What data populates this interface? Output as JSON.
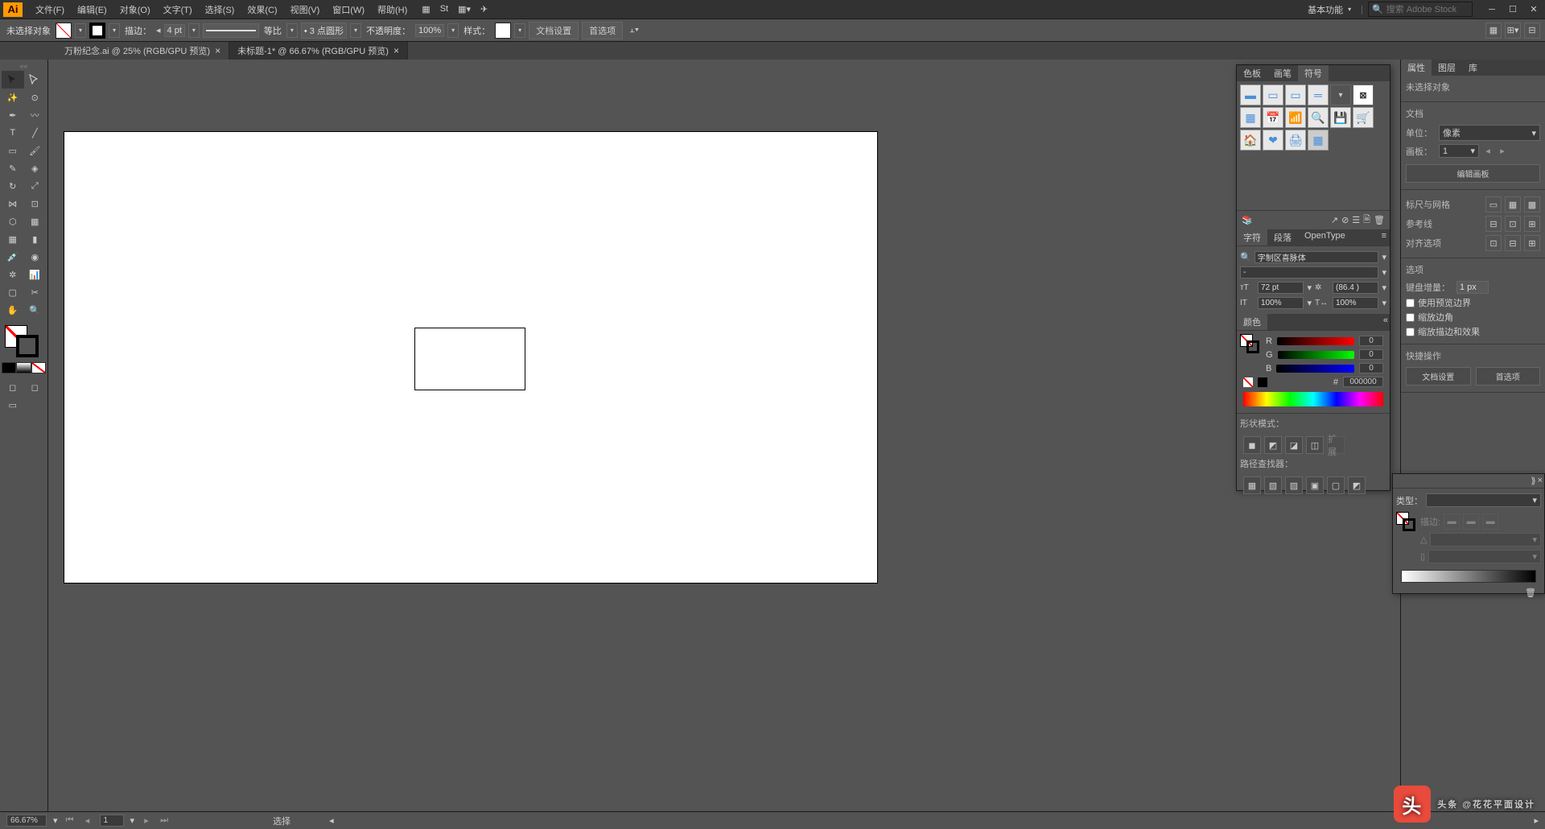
{
  "menubar": {
    "items": [
      "文件(F)",
      "编辑(E)",
      "对象(O)",
      "文字(T)",
      "选择(S)",
      "效果(C)",
      "视图(V)",
      "窗口(W)",
      "帮助(H)"
    ],
    "workspace": "基本功能",
    "search_placeholder": "搜索 Adobe Stock"
  },
  "control": {
    "no_selection": "未选择对象",
    "stroke_label": "描边：",
    "stroke_w": "4 pt",
    "uniform": "等比",
    "dash": "• 3 点圆形",
    "opacity_label": "不透明度：",
    "opacity": "100%",
    "style_label": "样式：",
    "doc_setup": "文档设置",
    "prefs": "首选项"
  },
  "tabs": [
    {
      "label": "万粉纪念.ai @ 25% (RGB/GPU 预览)",
      "active": false
    },
    {
      "label": "未标题-1* @ 66.67% (RGB/GPU 预览)",
      "active": true
    }
  ],
  "symbols_panel": {
    "tabs": [
      "色板",
      "画笔",
      "符号"
    ],
    "active": "符号"
  },
  "char_panel": {
    "tabs": [
      "字符",
      "段落",
      "OpenType"
    ],
    "font": "字制区喜脉体",
    "size": "72 pt",
    "leading": "(86.4 )",
    "vscale": "100%",
    "hscale": "100%"
  },
  "color_panel": {
    "title": "颜色",
    "r": "0",
    "g": "0",
    "b": "0",
    "hex": "000000"
  },
  "shape_panel": {
    "mode": "形状模式：",
    "pathfinder": "路径查找器："
  },
  "properties": {
    "tabs": [
      "属性",
      "图层",
      "库"
    ],
    "no_sel": "未选择对象",
    "doc": "文档",
    "unit_label": "单位：",
    "unit": "像素",
    "artboard_label": "画板：",
    "artboard": "1",
    "edit_artboard": "编辑画板",
    "ruler_grid": "标尺与网格",
    "guides": "参考线",
    "align": "对齐选项",
    "options": "选项",
    "kb_inc_label": "键盘增量：",
    "kb_inc": "1 px",
    "use_preview": "使用预览边界",
    "scale_corners": "缩放边角",
    "scale_strokes": "缩放描边和效果",
    "quick_ops": "快捷操作",
    "doc_setup_btn": "文档设置",
    "prefs_btn": "首选项",
    "type_label": "类型："
  },
  "status": {
    "zoom": "66.67%",
    "artboard": "1",
    "tool": "选择"
  },
  "watermark": "头条 @花花平面设计"
}
